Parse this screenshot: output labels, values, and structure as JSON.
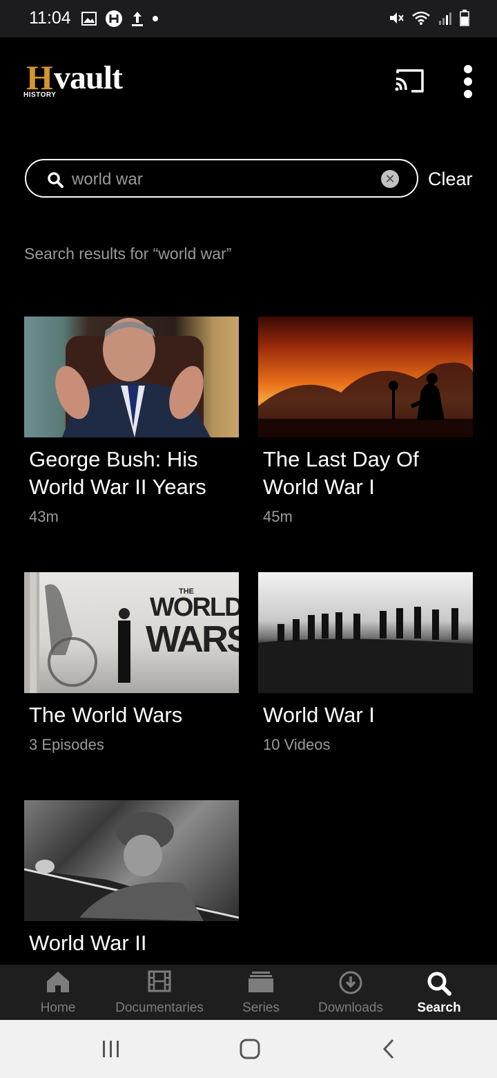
{
  "status_bar": {
    "time": "11:04"
  },
  "header": {
    "logo_h": "H",
    "logo_vault": "vault",
    "logo_sub": "HISTORY"
  },
  "search": {
    "query": "world war",
    "clear_label": "Clear",
    "results_label": "Search results for “world war”"
  },
  "results": [
    {
      "title": "George Bush: His World War II Years",
      "meta": "43m"
    },
    {
      "title": "The Last Day Of World War I",
      "meta": "45m"
    },
    {
      "title": "The World Wars",
      "meta": "3 Episodes"
    },
    {
      "title": "World War I",
      "meta": "10 Videos"
    },
    {
      "title": "World War II",
      "meta": ""
    }
  ],
  "thumb_text": {
    "the": "THE",
    "world": "WORLD",
    "wars": "WARS"
  },
  "bottom_nav": [
    {
      "label": "Home",
      "icon": "home-icon"
    },
    {
      "label": "Documentaries",
      "icon": "film-icon"
    },
    {
      "label": "Series",
      "icon": "series-icon"
    },
    {
      "label": "Downloads",
      "icon": "download-icon"
    },
    {
      "label": "Search",
      "icon": "search-icon",
      "active": true
    }
  ],
  "colors": {
    "accent": "#d4952b",
    "background": "#000000",
    "nav_bg": "#1e1e1e"
  }
}
